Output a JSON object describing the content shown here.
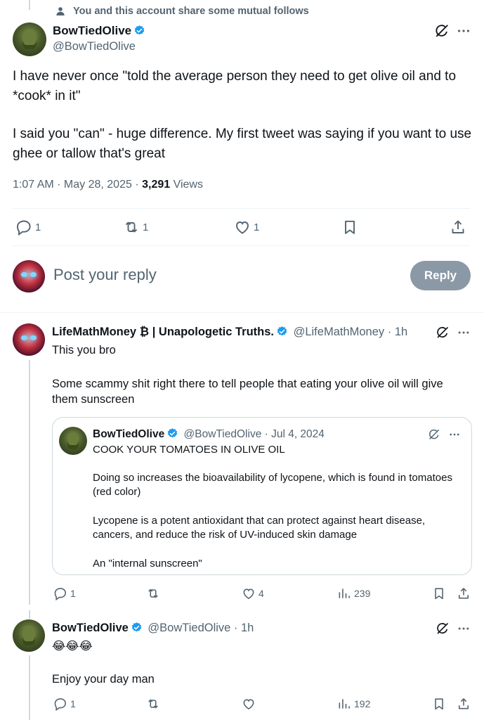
{
  "social_context": {
    "text": "You and this account share some mutual follows"
  },
  "main_tweet": {
    "display_name": "BowTiedOlive",
    "handle": "@BowTiedOlive",
    "paragraph1": "I have never once \"told the average person they need to get olive oil and to *cook* in it\"",
    "paragraph2": "I said you \"can\" - huge difference. My first tweet was saying if you want to use ghee or tallow that's great",
    "time": "1:07 AM · May 28, 2025 · ",
    "views_count": "3,291",
    "views_label": " Views",
    "replies": "1",
    "reposts": "1",
    "likes": "1"
  },
  "composer": {
    "placeholder": "Post your reply",
    "button_label": "Reply"
  },
  "reply1": {
    "display_name": "LifeMathMoney ₿ | Unapologetic Truths.",
    "handle_time": "@LifeMathMoney · 1h",
    "line1": "This you bro",
    "line2": "Some scammy shit right there to tell people that eating your olive oil will give them sunscreen",
    "replies": "1",
    "reposts": "",
    "likes": "4",
    "views": "239",
    "quote": {
      "display_name": "BowTiedOlive",
      "handle_time": "@BowTiedOlive · Jul 4, 2024",
      "line1": "COOK YOUR TOMATOES IN OLIVE OIL",
      "line2": "Doing so increases the bioavailability of lycopene, which is found in tomatoes (red color)",
      "line3": "Lycopene is a potent antioxidant that can protect against heart disease, cancers, and reduce the risk of UV-induced skin damage",
      "line4": "An \"internal sunscreen\""
    }
  },
  "reply2": {
    "display_name": "BowTiedOlive",
    "handle_time": "@BowTiedOlive · 1h",
    "emoji": "😂😂😂",
    "line1": "Enjoy your day man",
    "replies": "1",
    "reposts": "",
    "likes": "",
    "views": "192"
  },
  "colors": {
    "text": "#0f1419",
    "muted": "#536471",
    "verified": "#1d9bf0",
    "reply_button": "#8b98a5",
    "border": "#cfd9de"
  },
  "icons": [
    "person-icon",
    "verified-badge-icon",
    "grok-icon",
    "more-icon",
    "reply-icon",
    "repost-icon",
    "like-icon",
    "views-icon",
    "bookmark-icon",
    "share-icon"
  ]
}
